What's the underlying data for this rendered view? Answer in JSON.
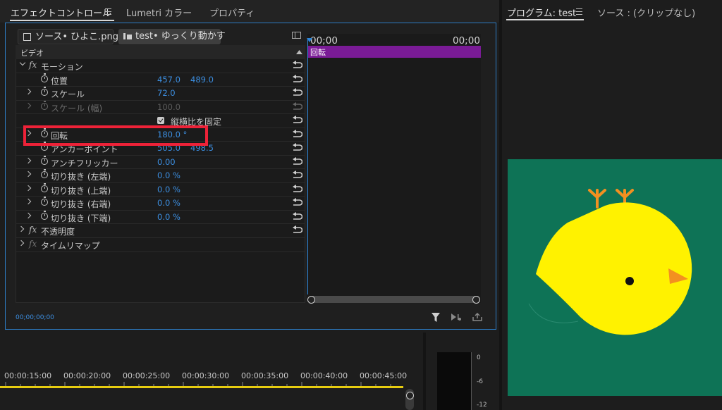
{
  "tabs": {
    "effect_controls": "エフェクトコントロール",
    "lumetri": "Lumetri カラー",
    "properties": "プロパティ"
  },
  "clip_tabs": {
    "source": "ソース• ひよこ.png",
    "sequence": "test• ゆっくり動かす"
  },
  "section_video": "ビデオ",
  "effects": {
    "motion": "モーション",
    "opacity": "不透明度",
    "time_remap": "タイムリマップ"
  },
  "properties": {
    "position": {
      "label": "位置",
      "x": "457.0",
      "y": "489.0"
    },
    "scale": {
      "label": "スケール",
      "value": "72.0"
    },
    "scale_width": {
      "label": "スケール (幅)",
      "value": "100.0"
    },
    "uniform_scale": {
      "label": "縦横比を固定"
    },
    "rotation": {
      "label": "回転",
      "value": "180.0 °"
    },
    "anchor": {
      "label": "アンカーポイント",
      "x": "505.0",
      "y": "498.5"
    },
    "antiflicker": {
      "label": "アンチフリッカー",
      "value": "0.00"
    },
    "crop_left": {
      "label": "切り抜き (左端)",
      "value": "0.0 %"
    },
    "crop_top": {
      "label": "切り抜き (上端)",
      "value": "0.0 %"
    },
    "crop_right": {
      "label": "切り抜き (右端)",
      "value": "0.0 %"
    },
    "crop_bottom": {
      "label": "切り抜き (下端)",
      "value": "0.0 %"
    }
  },
  "timeline": {
    "tc_left": "00;00",
    "tc_right": "00;00",
    "clip_label": "回転"
  },
  "ec_timecode": "00;00;00;00",
  "program": {
    "title": "プログラム: test",
    "source_title": "ソース : (クリップなし)"
  },
  "bottom_ticks": [
    "00:00:15:00",
    "00:00:20:00",
    "00:00:25:00",
    "00:00:30:00",
    "00:00:35:00",
    "00:00:40:00",
    "00:00:45:00"
  ],
  "meter_labels": [
    "0",
    "-6",
    "-12"
  ],
  "colors": {
    "accent_blue": "#2d7cc4",
    "value_blue": "#3c8ee0",
    "clip_purple": "#7a1b96",
    "video_bg": "#0e7356",
    "chick_yellow": "#fff200",
    "beak_orange": "#f39020",
    "highlight_red": "#ee2238",
    "timeline_yellow": "#e6cc10"
  },
  "icons": {
    "menu": "hamburger-menu-icon",
    "reset": "reset-arrow-icon",
    "stopwatch": "stopwatch-icon",
    "filter": "filter-funnel-icon"
  }
}
